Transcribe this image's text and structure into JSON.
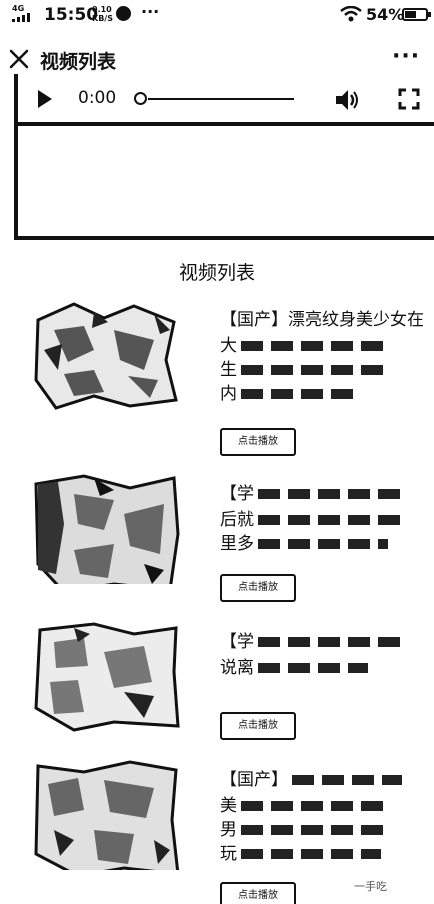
{
  "status_bar": {
    "network": "4G",
    "time": "15:50",
    "speed_value": "0.10",
    "speed_unit": "KB/S",
    "more": "···",
    "battery": "54%",
    "battery_level": 0.54
  },
  "header": {
    "title": "视频列表",
    "more": "···"
  },
  "player": {
    "time": "0:00",
    "progress": 0
  },
  "list": {
    "heading": "视频列表",
    "items": [
      {
        "title": "【国产】漂亮纹身美少女在",
        "lines": [
          "大",
          "生",
          "内"
        ],
        "play_label": "点击播放"
      },
      {
        "title": "【学",
        "lines": [
          "后就",
          "里多"
        ],
        "play_label": "点击播放"
      },
      {
        "title": "【学",
        "lines": [
          "说离"
        ],
        "play_label": "点击播放"
      },
      {
        "title": "【国产】",
        "lines": [
          "美",
          "男",
          "玩"
        ],
        "play_label": "点击播放"
      }
    ]
  },
  "watermark": "一手吃"
}
